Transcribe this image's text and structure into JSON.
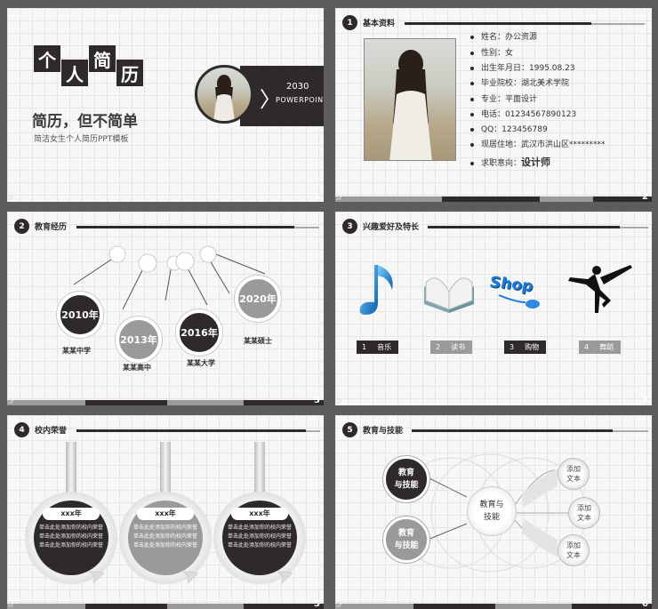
{
  "slides": [
    {
      "num": "1",
      "title_chars": [
        "个",
        "人",
        "简",
        "历"
      ],
      "subtitle": "简历，但不简单",
      "desc": "简洁女生个人简历PPT模板",
      "badge_line1": "2030",
      "badge_line2": "POWERPOINT"
    },
    {
      "num": "2",
      "sec_num": "1",
      "sec_title": "基本资料",
      "info": [
        {
          "k": "姓名：",
          "v": "办公资源"
        },
        {
          "k": "性别：",
          "v": "女"
        },
        {
          "k": "出生年月日：",
          "v": "1995.08.23"
        },
        {
          "k": "毕业院校：",
          "v": "湖北美术学院"
        },
        {
          "k": "专业：",
          "v": "平面设计"
        },
        {
          "k": "电话：",
          "v": "01234567890123"
        },
        {
          "k": "QQ：",
          "v": "123456789"
        },
        {
          "k": "现居住地：",
          "v": "武汉市洪山区*********"
        },
        {
          "k": "求职意向：",
          "v": "设计师"
        }
      ]
    },
    {
      "num": "3",
      "sec_num": "2",
      "sec_title": "教育经历",
      "years": [
        "2010年",
        "2013年",
        "2016年",
        "2020年"
      ],
      "schools": [
        "某某中学",
        "某某高中",
        "某某大学",
        "某某硕士"
      ]
    },
    {
      "num": "4",
      "sec_num": "3",
      "sec_title": "兴趣爱好及特长",
      "hobbies": [
        {
          "n": "1",
          "label": "音乐"
        },
        {
          "n": "2",
          "label": "读书"
        },
        {
          "n": "3",
          "label": "购物"
        },
        {
          "n": "4",
          "label": "舞蹈"
        }
      ],
      "shop_word": "Shop"
    },
    {
      "num": "5",
      "sec_num": "4",
      "sec_title": "校内荣誉",
      "awards": [
        {
          "year": "xxx年",
          "text": "单击此处添加你的校内荣誉单击此处添加你的校内荣誉单击此处添加你的校内荣誉"
        },
        {
          "year": "xxx年",
          "text": "单击此处添加你的校内荣誉单击此处添加你的校内荣誉单击此处添加你的校内荣誉"
        },
        {
          "year": "xxx年",
          "text": "单击此处添加你的校内荣誉单击此处添加你的校内荣誉单击此处添加你的校内荣誉"
        }
      ]
    },
    {
      "num": "6",
      "sec_num": "5",
      "sec_title": "教育与技能",
      "left_nodes": [
        "教育\n与技能",
        "教育\n与技能"
      ],
      "center": "教育与\n技能",
      "right_nodes": [
        "添加\n文本",
        "添加\n文本",
        "添加\n文本"
      ]
    }
  ],
  "colors": {
    "dark": "#2e2a2b",
    "gray": "#9a9a9a",
    "bg": "#5d5d5d"
  },
  "icons": {
    "star": "star-icon",
    "music": "music-note-icon",
    "book": "book-icon",
    "shop": "shop-mouse-icon",
    "dance": "dancer-icon",
    "cursor": "cursor-icon"
  }
}
